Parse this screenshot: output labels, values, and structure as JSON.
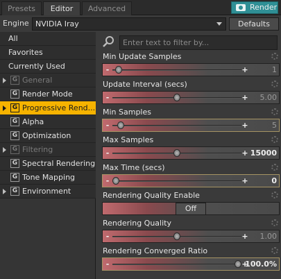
{
  "tabs": [
    {
      "label": "Presets",
      "active": false
    },
    {
      "label": "Editor",
      "active": true
    },
    {
      "label": "Advanced",
      "active": false
    }
  ],
  "render_button": {
    "label": "Render",
    "icon": "camera-icon",
    "color": "#2f8f95"
  },
  "engine": {
    "label": "Engine :",
    "value": "NVIDIA Iray"
  },
  "defaults_label": "Defaults",
  "sidebar": {
    "items": [
      {
        "label": "All",
        "kind": "plain"
      },
      {
        "label": "Favorites",
        "kind": "plain"
      },
      {
        "label": "Currently Used",
        "kind": "plain"
      },
      {
        "label": "General",
        "kind": "group",
        "expander": true,
        "disabled": true
      },
      {
        "label": "Render Mode",
        "kind": "group",
        "expander": false
      },
      {
        "label": "Progressive Rend...",
        "kind": "group",
        "expander": true,
        "selected": true
      },
      {
        "label": "Alpha",
        "kind": "group",
        "expander": false
      },
      {
        "label": "Optimization",
        "kind": "group",
        "expander": false
      },
      {
        "label": "Filtering",
        "kind": "group",
        "expander": true,
        "disabled": true
      },
      {
        "label": "Spectral Rendering",
        "kind": "group",
        "expander": false
      },
      {
        "label": "Tone Mapping",
        "kind": "group",
        "expander": false
      },
      {
        "label": "Environment",
        "kind": "group",
        "expander": true
      }
    ],
    "group_icon_glyph": "G",
    "selected_color": "#f6b300"
  },
  "filter": {
    "placeholder": "Enter text to filter by..."
  },
  "properties": [
    {
      "title": "Min Update Samples",
      "value": "1",
      "fraction": 0.02,
      "type": "slider",
      "bold": false
    },
    {
      "title": "Update Interval (secs)",
      "value": "5.00",
      "fraction": 0.5,
      "type": "slider",
      "bold": false
    },
    {
      "title": "Min Samples",
      "value": "5",
      "fraction": 0.04,
      "type": "slider",
      "bold": false,
      "highlight": true
    },
    {
      "title": "Max Samples",
      "value": "15000",
      "fraction": 0.5,
      "type": "slider",
      "bold": true
    },
    {
      "title": "Max Time (secs)",
      "value": "0",
      "fraction": 0.0,
      "type": "slider",
      "bold": true,
      "highlight": true
    },
    {
      "title": "Rendering Quality Enable",
      "value": "Off",
      "type": "toggle"
    },
    {
      "title": "Rendering Quality",
      "value": "1.00",
      "fraction": 0.5,
      "type": "slider",
      "bold": false
    },
    {
      "title": "Rendering Converged Ratio",
      "value": "100.0%",
      "fraction": 1.0,
      "type": "slider",
      "bold": true,
      "highlight": true
    }
  ]
}
